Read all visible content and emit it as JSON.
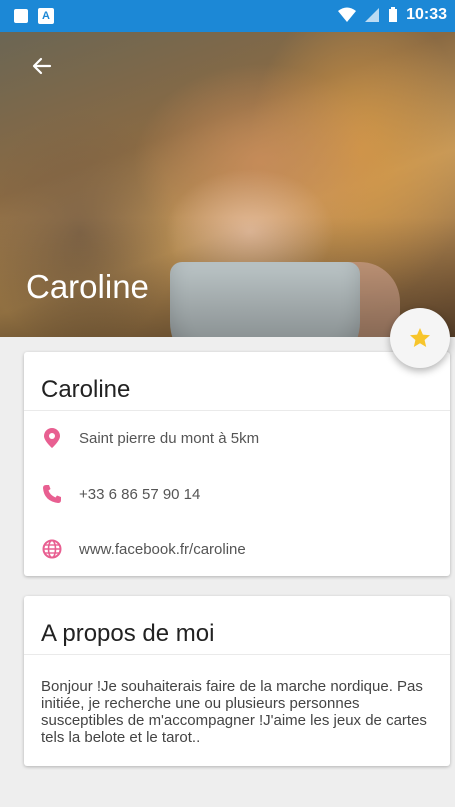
{
  "status_bar": {
    "time": "10:33",
    "left_icons": [
      "sd-card-icon",
      "a-notification-icon"
    ],
    "right_icons": [
      "wifi-icon",
      "signal-icon",
      "battery-icon"
    ]
  },
  "header": {
    "back_icon": "arrow-left-icon",
    "title": "Caroline"
  },
  "fab": {
    "icon": "star-icon",
    "color": "#f7c52b"
  },
  "profile_card": {
    "name": "Caroline",
    "items": [
      {
        "icon": "location-pin-icon",
        "text": "Saint pierre du mont à 5km"
      },
      {
        "icon": "phone-icon",
        "text": "+33 6 86 57 90 14"
      },
      {
        "icon": "globe-icon",
        "text": "www.facebook.fr/caroline"
      }
    ],
    "accent_color": "#e85f91"
  },
  "about_card": {
    "title": "A propos de moi",
    "text": "Bonjour !Je souhaiterais faire de la marche nordique. Pas initiée, je recherche une ou plusieurs personnes susceptibles de m'accompagner !J'aime les jeux de cartes tels la belote et le tarot.."
  },
  "colors": {
    "status_bar": "#1c88d6",
    "background": "#eeeeee"
  }
}
